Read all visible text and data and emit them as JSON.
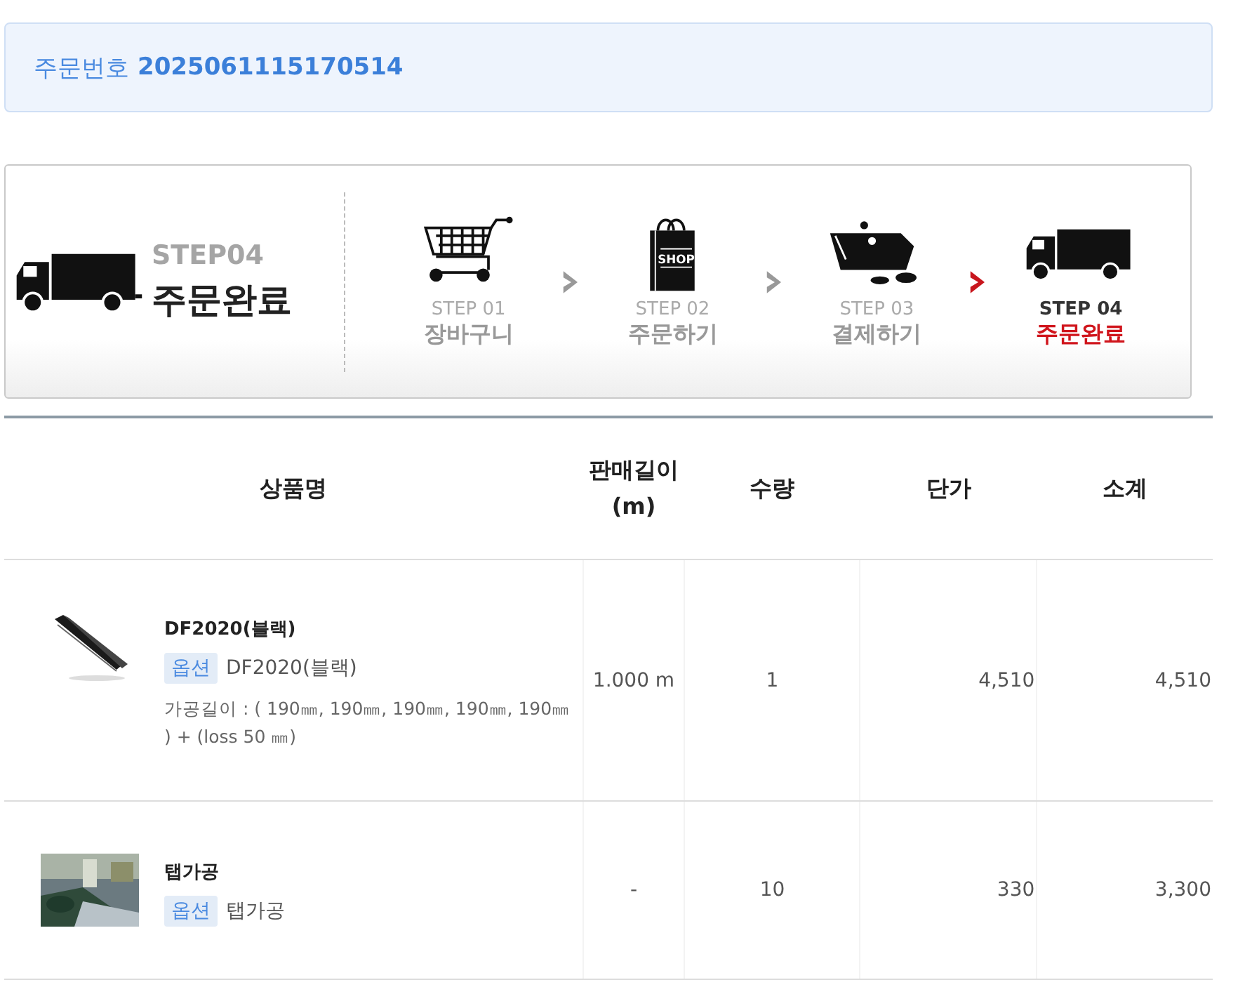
{
  "order": {
    "label": "주문번호",
    "number": "2025061115170514"
  },
  "progress": {
    "current_label": "STEP04",
    "current_title": "주문완료",
    "steps": [
      {
        "kind": "cart",
        "label": "STEP 01",
        "name": "장바구니",
        "selected": false
      },
      {
        "kind": "bag",
        "label": "STEP 02",
        "name": "주문하기",
        "bag_text": "SHOP",
        "selected": false
      },
      {
        "kind": "wallet",
        "label": "STEP 03",
        "name": "결제하기",
        "selected": false
      },
      {
        "kind": "truck",
        "label": "STEP 04",
        "name": "주문완료",
        "selected": true
      }
    ]
  },
  "table": {
    "columns": [
      "상품명",
      "판매길이\n(m)",
      "수량",
      "단가",
      "소계"
    ],
    "rows": [
      {
        "name": "DF2020(블랙)",
        "option_tag": "옵션",
        "option": "DF2020(블랙)",
        "detail": "가공길이 : ( 190㎜, 190㎜, 190㎜, 190㎜, 190㎜ ) + (loss 50 ㎜)",
        "length": "1.000 m",
        "qty": "1",
        "price": "4,510",
        "subtotal": "4,510"
      },
      {
        "name": "탭가공",
        "option_tag": "옵션",
        "option": "탭가공",
        "length": "-",
        "qty": "10",
        "price": "330",
        "subtotal": "3,300"
      }
    ]
  }
}
